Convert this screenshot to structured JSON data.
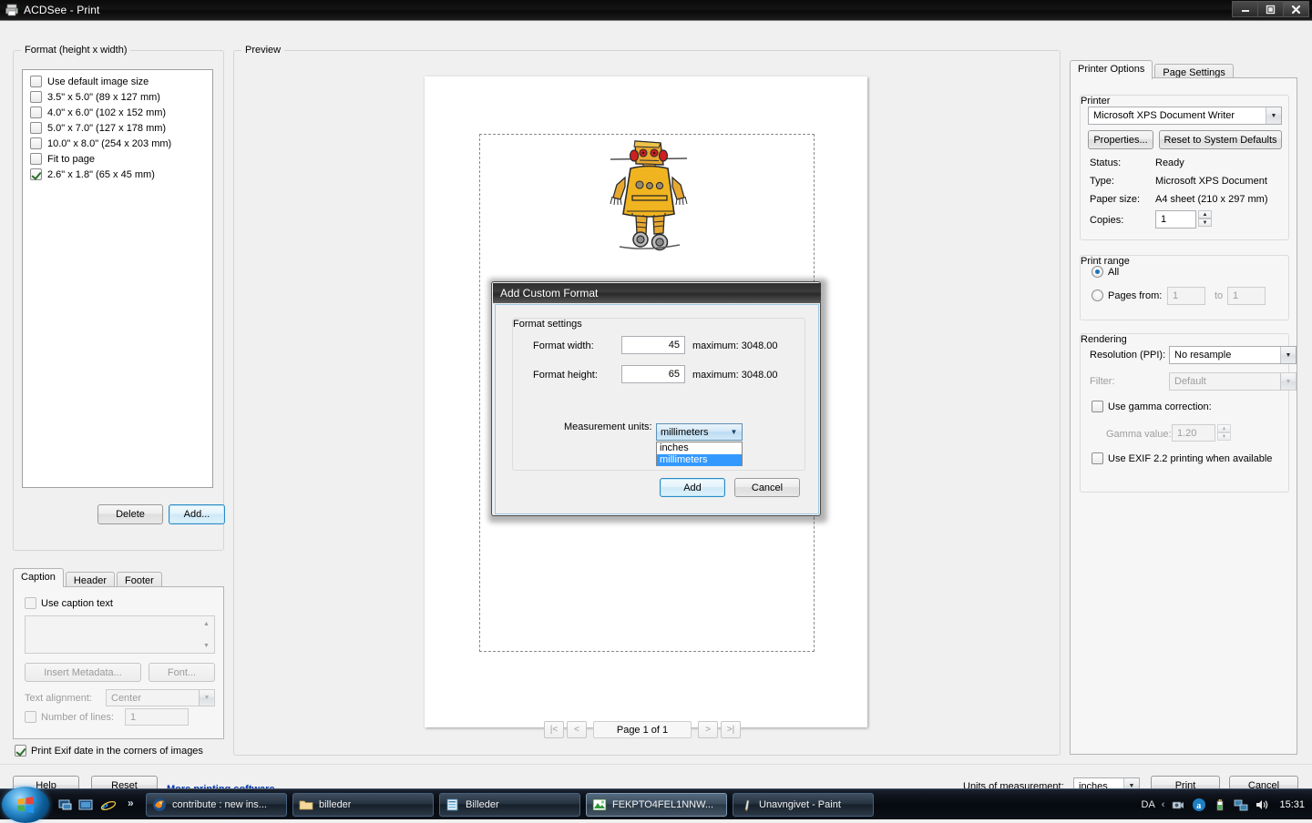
{
  "window": {
    "title": "ACDSee - Print",
    "icon": "printer-icon",
    "minimize_label": "–",
    "maximize_label": "❐",
    "close_label": "✕"
  },
  "format_panel": {
    "group_label": "Format (height x width)",
    "items": [
      {
        "label": "Use default image size",
        "checked": false
      },
      {
        "label": "3.5\" x 5.0\" (89 x 127 mm)",
        "checked": false
      },
      {
        "label": "4.0\" x 6.0\" (102 x 152 mm)",
        "checked": false
      },
      {
        "label": "5.0\" x 7.0\" (127 x 178 mm)",
        "checked": false
      },
      {
        "label": "10.0\" x 8.0\" (254 x 203 mm)",
        "checked": false
      },
      {
        "label": "Fit to page",
        "checked": false
      },
      {
        "label": "2.6\" x 1.8\" (65 x 45 mm)",
        "checked": true
      }
    ],
    "delete_label": "Delete",
    "add_label": "Add..."
  },
  "caption_panel": {
    "tabs": [
      {
        "label": "Caption",
        "active": true
      },
      {
        "label": "Header",
        "active": false
      },
      {
        "label": "Footer",
        "active": false
      }
    ],
    "use_caption_label": "Use caption text",
    "use_caption_checked": false,
    "caption_text": "",
    "insert_metadata_label": "Insert Metadata...",
    "font_label": "Font...",
    "text_alignment_label": "Text alignment:",
    "text_alignment_value": "Center",
    "number_of_lines_label": "Number of lines:",
    "number_of_lines_value": "1",
    "number_of_lines_checked": false,
    "print_exif_label": "Print Exif date in the corners of images",
    "print_exif_checked": true
  },
  "preview": {
    "group_label": "Preview",
    "image_name": "yellow-robot-drawing",
    "pager": {
      "first_label": "|<",
      "prev_label": "<",
      "page_label": "Page 1 of 1",
      "next_label": ">",
      "last_label": ">|"
    }
  },
  "right_panel": {
    "tabs": [
      {
        "label": "Printer Options",
        "active": true
      },
      {
        "label": "Page Settings",
        "active": false
      }
    ],
    "printer": {
      "group_label": "Printer",
      "selected": "Microsoft XPS Document Writer",
      "properties_label": "Properties...",
      "reset_label": "Reset to System Defaults",
      "status_label": "Status:",
      "status_value": "Ready",
      "type_label": "Type:",
      "type_value": "Microsoft XPS Document",
      "paper_label": "Paper size:",
      "paper_value": "A4 sheet (210 x 297 mm)",
      "copies_label": "Copies:",
      "copies_value": "1"
    },
    "print_range": {
      "group_label": "Print range",
      "all_label": "All",
      "all_selected": true,
      "pages_from_label": "Pages from:",
      "pages_from_selected": false,
      "from_value": "1",
      "to_label": "to",
      "to_value": "1"
    },
    "rendering": {
      "group_label": "Rendering",
      "resolution_label": "Resolution (PPI):",
      "resolution_value": "No resample",
      "filter_label": "Filter:",
      "filter_value": "Default",
      "gamma_check_label": "Use gamma correction:",
      "gamma_checked": false,
      "gamma_value_label": "Gamma value:",
      "gamma_value": "1.20",
      "exif_label": "Use EXIF 2.2 printing when available",
      "exif_checked": false
    }
  },
  "bottom_bar": {
    "help_label": "Help",
    "reset_label": "Reset",
    "more_software_label": "More printing software",
    "units_label": "Units of measurement:",
    "units_value": "inches",
    "print_label": "Print",
    "cancel_label": "Cancel"
  },
  "dialog": {
    "title": "Add Custom Format",
    "group_label": "Format settings",
    "width_label": "Format width:",
    "width_value": "45",
    "width_max": "maximum: 3048.00",
    "height_label": "Format height:",
    "height_value": "65",
    "height_max": "maximum: 3048.00",
    "units_label": "Measurement units:",
    "units_value": "millimeters",
    "units_options": [
      {
        "label": "inches",
        "selected": false
      },
      {
        "label": "millimeters",
        "selected": true
      }
    ],
    "add_label": "Add",
    "cancel_label": "Cancel"
  },
  "taskbar": {
    "start_label": "start-orb",
    "quicklaunch": [
      {
        "name": "show-desktop-icon"
      },
      {
        "name": "flip3d-icon"
      },
      {
        "name": "internet-explorer-icon"
      }
    ],
    "chevron": "»",
    "items": [
      {
        "label": "contribute : new ins...",
        "icon": "firefox-icon",
        "active": false
      },
      {
        "label": "billeder",
        "icon": "folder-icon",
        "active": false
      },
      {
        "label": "Billeder",
        "icon": "explorer-icon",
        "active": false
      },
      {
        "label": "FEKPTO4FEL1NNW...",
        "icon": "acdsee-icon",
        "active": true
      },
      {
        "label": "Unavngivet - Paint",
        "icon": "paint-icon",
        "active": false
      }
    ],
    "tray": {
      "language": "DA",
      "chevron": "‹",
      "icons": [
        "network-camera-icon",
        "acrobat-icon",
        "battery-icon",
        "network-icon",
        "volume-icon"
      ],
      "clock": "15:31"
    }
  },
  "colors": {
    "accent_blue": "#3399ff",
    "link_blue": "#0033aa",
    "window_bg": "#f0f0f0",
    "panel_bg": "#f6f6f6"
  }
}
